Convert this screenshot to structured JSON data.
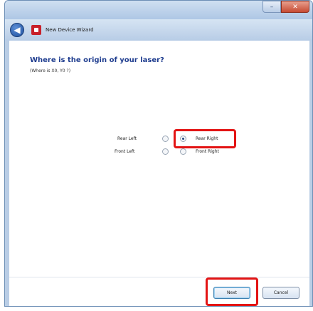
{
  "window": {
    "title": "New Device Wizard",
    "buttons": {
      "minimize": "–",
      "close": "✕"
    }
  },
  "wizard": {
    "heading": "Where is the origin of your laser?",
    "subheading": "(Where is X0, Y0 ?)",
    "options": {
      "rear_left": "Rear Left",
      "rear_right": "Rear Right",
      "front_left": "Front Left",
      "front_right": "Front Right",
      "selected": "Rear Right"
    }
  },
  "footer": {
    "next_label": "Next",
    "cancel_label": "Cancel"
  },
  "colors": {
    "highlight": "#e31414",
    "heading": "#1f3d8f"
  },
  "icons": [
    "back-arrow-icon",
    "app-icon",
    "minimize-icon",
    "close-icon"
  ]
}
